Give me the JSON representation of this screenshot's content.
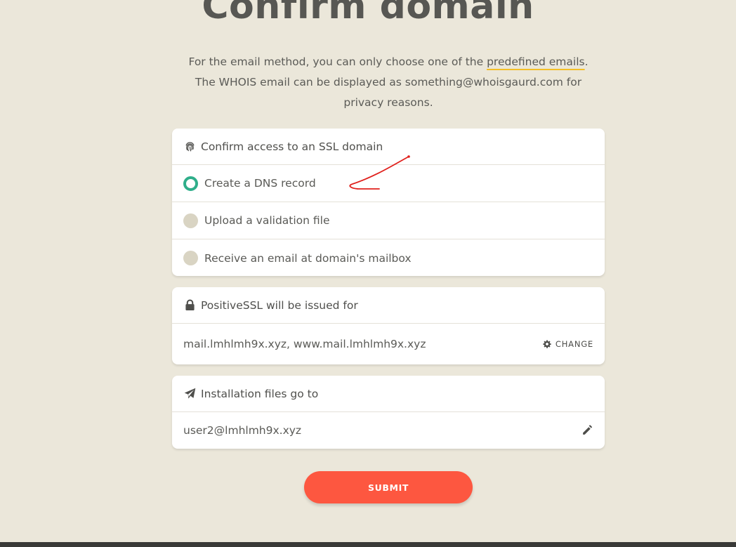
{
  "page": {
    "title": "Confirm domain",
    "intro": {
      "part1": "For the email method, you can only choose one of the ",
      "highlight": "predefined emails",
      "part2": ". The WHOIS email can be displayed as something@whoisgaurd.com for privacy reasons."
    }
  },
  "ssl_card": {
    "icon": "fingerprint-icon",
    "title": "Confirm access to an SSL domain",
    "options": [
      {
        "label": "Create a DNS record",
        "selected": true
      },
      {
        "label": "Upload a validation file",
        "selected": false
      },
      {
        "label": "Receive an email at domain's mailbox",
        "selected": false
      }
    ]
  },
  "issued_card": {
    "icon": "lock-icon",
    "title": "PositiveSSL will be issued for",
    "domains": "mail.lmhlmh9x.xyz, www.mail.lmhlmh9x.xyz",
    "change_label": "CHANGE"
  },
  "install_card": {
    "icon": "paper-plane-icon",
    "title": "Installation files go to",
    "email": "user2@lmhlmh9x.xyz"
  },
  "submit_label": "SUBMIT",
  "colors": {
    "background": "#ebe7da",
    "accent_green": "#2fae8a",
    "submit": "#fd5740",
    "highlight_underline": "#f3bf27",
    "annotation_red": "#e0201c"
  }
}
